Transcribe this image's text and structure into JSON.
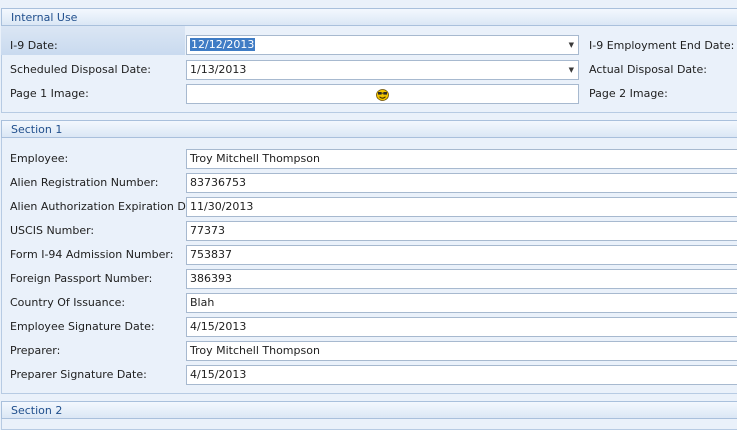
{
  "internal_use": {
    "title": "Internal Use",
    "i9_date_label": "I-9 Date:",
    "i9_date_value": "12/12/2013",
    "i9_employment_end_label": "I-9 Employment End Date:",
    "scheduled_disposal_label": "Scheduled Disposal Date:",
    "scheduled_disposal_value": "1/13/2013",
    "actual_disposal_label": "Actual Disposal Date:",
    "page1_label": "Page 1 Image:",
    "page2_label": "Page 2 Image:"
  },
  "section1": {
    "title": "Section 1",
    "fields": [
      {
        "label": "Employee:",
        "value": "Troy Mitchell Thompson"
      },
      {
        "label": "Alien Registration Number:",
        "value": "83736753"
      },
      {
        "label": "Alien Authorization Expiration Date:",
        "value": "11/30/2013"
      },
      {
        "label": "USCIS Number:",
        "value": "77373"
      },
      {
        "label": "Form I-94 Admission Number:",
        "value": "753837"
      },
      {
        "label": "Foreign Passport Number:",
        "value": "386393"
      },
      {
        "label": "Country Of Issuance:",
        "value": "Blah"
      },
      {
        "label": "Employee Signature Date:",
        "value": "4/15/2013"
      },
      {
        "label": "Preparer:",
        "value": "Troy Mitchell Thompson"
      },
      {
        "label": "Preparer Signature Date:",
        "value": "4/15/2013"
      }
    ]
  },
  "section2": {
    "title": "Section 2"
  },
  "icons": {
    "dropdown": "chevron-down-icon",
    "image_placeholder": "smiley-face-icon"
  },
  "colors": {
    "background": "#eaf1fa",
    "header_text": "#1f4e8c",
    "selection": "#3f7cc5"
  }
}
